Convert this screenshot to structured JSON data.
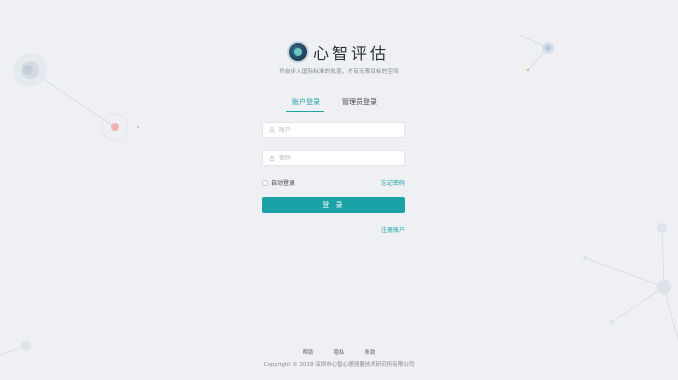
{
  "brand": {
    "name": "心智评估",
    "slogan": "开启步入国际标准的轨道，才有无限目标的空间",
    "logo_icon": "brain-logo-icon"
  },
  "tabs": [
    {
      "label": "账户登录",
      "active": true
    },
    {
      "label": "管理员登录",
      "active": false
    }
  ],
  "form": {
    "username_placeholder": "账户",
    "password_placeholder": "密码",
    "remember_label": "自动登录",
    "forgot_label": "忘记密码",
    "login_label": "登 录",
    "register_label": "注册账户"
  },
  "footer": {
    "links": [
      "帮助",
      "隐私",
      "条款"
    ],
    "copyright": "Copyright © 2018 深圳市心智心理测量技术研究所有限公司"
  },
  "colors": {
    "accent": "#1aa2a6",
    "background": "#eef0f4"
  }
}
